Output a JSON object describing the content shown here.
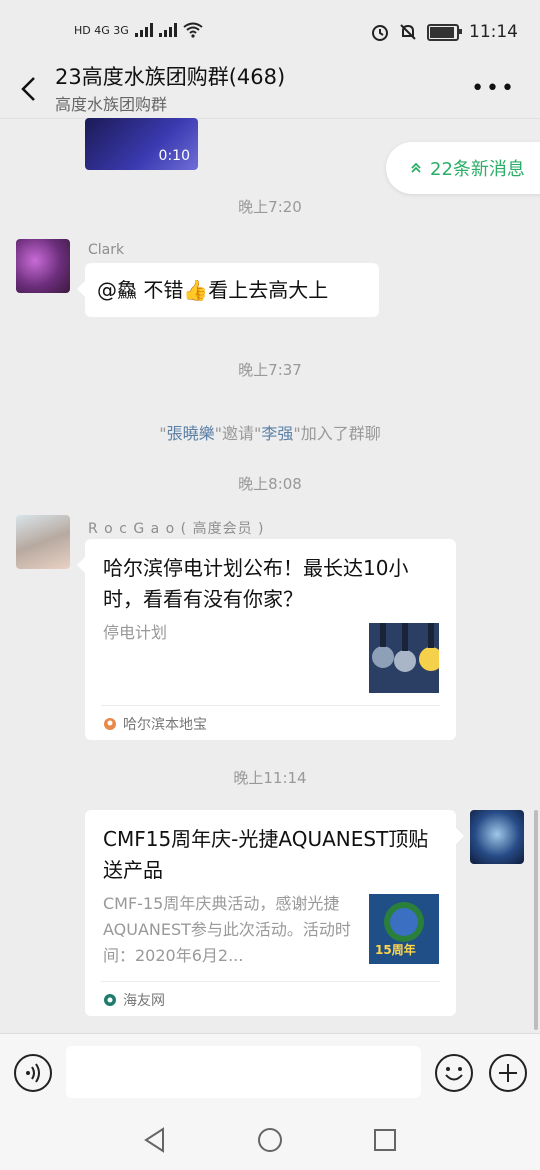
{
  "status_bar": {
    "left_icons": "HD 4G 3G",
    "time": "11:14"
  },
  "header": {
    "title": "23高度水族团购群(468)",
    "subtitle": "高度水族团购群"
  },
  "video": {
    "duration": "0:10"
  },
  "new_messages": {
    "label": "22条新消息"
  },
  "times": [
    "晚上7:20",
    "晚上7:37",
    "晚上8:08",
    "晚上11:14"
  ],
  "msg1": {
    "sender": "Clark",
    "text": "@鱻  不错👍看上去高大上"
  },
  "system_msg": {
    "q1": "\"",
    "name1": "張曉樂",
    "q2": "\"邀请\"",
    "name2": "李强",
    "q3": "\"加入了群聊"
  },
  "msg2": {
    "sender": "R o c G a o ( 高度会员 )",
    "title": "哈尔滨停电计划公布！最长达10小时，看看有没有你家？",
    "desc": "停电计划",
    "source": "哈尔滨本地宝"
  },
  "msg3": {
    "title": "CMF15周年庆-光捷AQUANEST顶贴送产品",
    "desc": "CMF-15周年庆典活动，感谢光捷AQUANEST参与此次活动。活动时间：2020年6月2...",
    "source": "海友网",
    "thumb_badge": "15周年"
  }
}
